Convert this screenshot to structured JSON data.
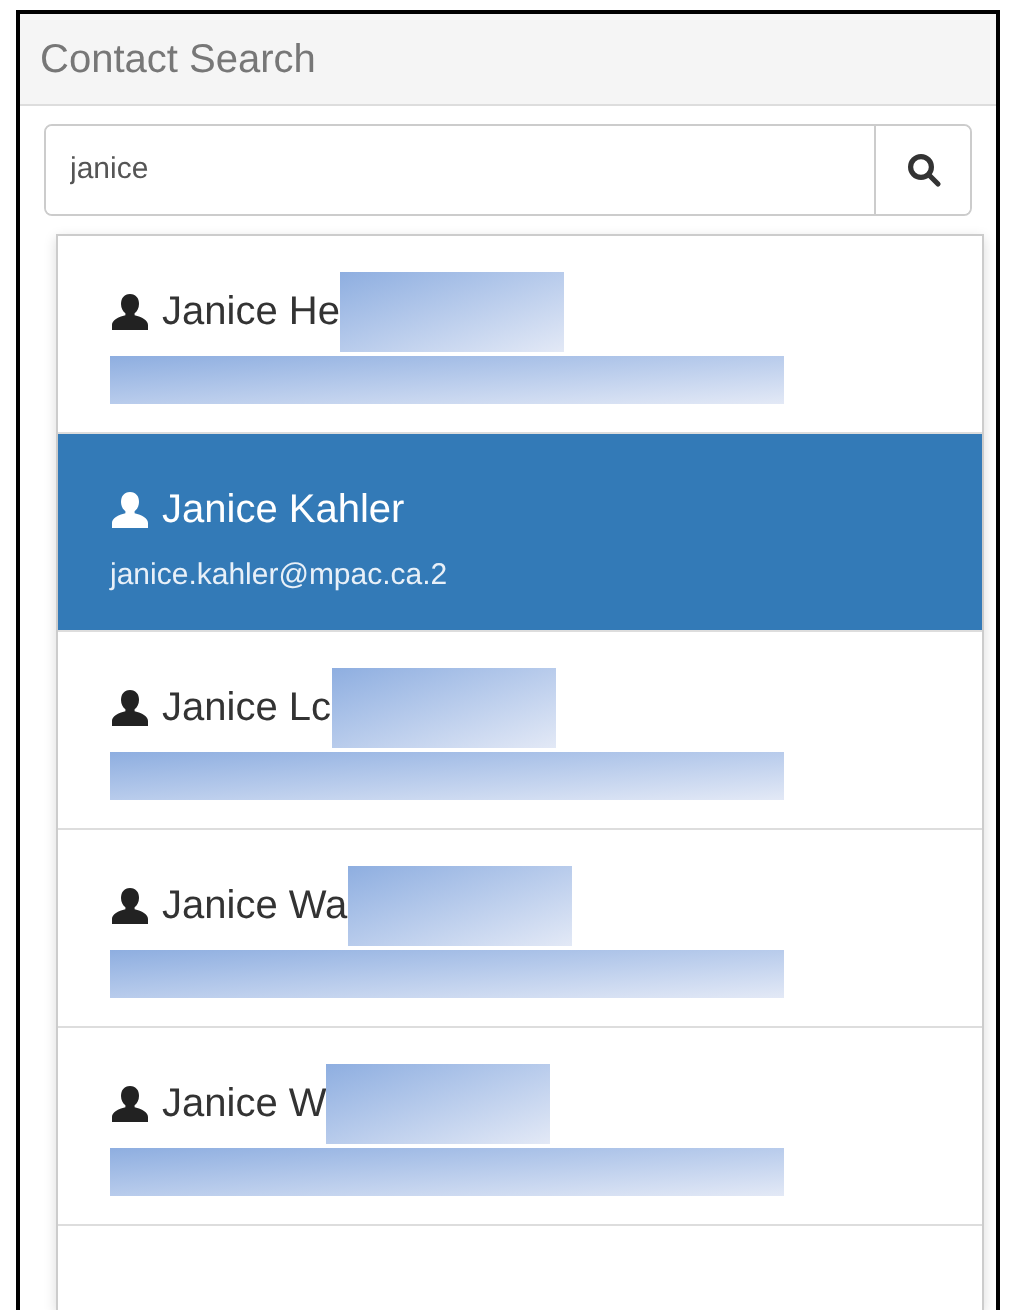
{
  "panel": {
    "title": "Contact Search"
  },
  "search": {
    "value": "janice"
  },
  "results": [
    {
      "name": "Janice He",
      "redacted": true,
      "selected": false
    },
    {
      "name": "Janice Kahler",
      "email": "janice.kahler@mpac.ca.2",
      "redacted": false,
      "selected": true
    },
    {
      "name": "Janice Lc",
      "redacted": true,
      "selected": false
    },
    {
      "name": "Janice Wa",
      "redacted": true,
      "selected": false
    },
    {
      "name": "Janice W",
      "redacted": true,
      "selected": false
    }
  ]
}
